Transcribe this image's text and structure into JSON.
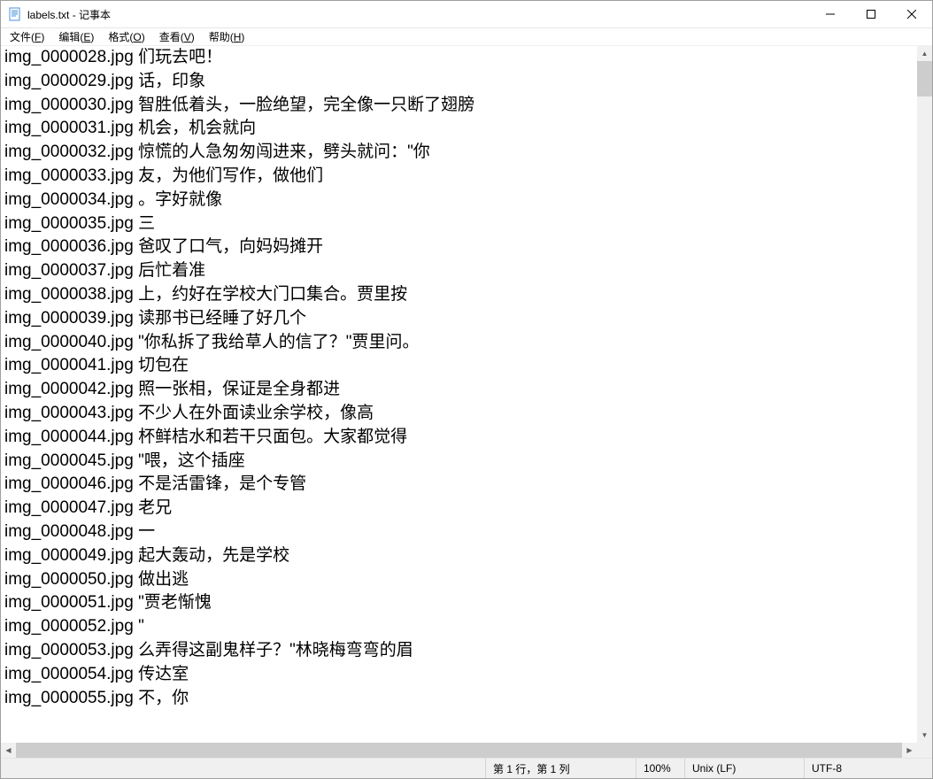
{
  "window": {
    "title": "labels.txt - 记事本"
  },
  "menu": {
    "file": "文件(",
    "file_u": "F",
    "file_end": ")",
    "edit": "编辑(",
    "edit_u": "E",
    "edit_end": ")",
    "format": "格式(",
    "format_u": "O",
    "format_end": ")",
    "view": "查看(",
    "view_u": "V",
    "view_end": ")",
    "help": "帮助(",
    "help_u": "H",
    "help_end": ")"
  },
  "content": {
    "lines": [
      "img_0000028.jpg 们玩去吧！",
      "img_0000029.jpg 话，印象",
      "img_0000030.jpg 智胜低着头，一脸绝望，完全像一只断了翅膀",
      "img_0000031.jpg 机会，机会就向",
      "img_0000032.jpg 惊慌的人急匆匆闯进来，劈头就问：\"你",
      "img_0000033.jpg 友，为他们写作，做他们",
      "img_0000034.jpg 。字好就像",
      "img_0000035.jpg 三",
      "img_0000036.jpg 爸叹了口气，向妈妈摊开",
      "img_0000037.jpg 后忙着准",
      "img_0000038.jpg 上，约好在学校大门口集合。贾里按",
      "img_0000039.jpg 读那书已经睡了好几个",
      "img_0000040.jpg \"你私拆了我给草人的信了？\"贾里问。",
      "img_0000041.jpg 切包在",
      "img_0000042.jpg 照一张相，保证是全身都进",
      "img_0000043.jpg 不少人在外面读业余学校，像高",
      "img_0000044.jpg 杯鲜桔水和若干只面包。大家都觉得",
      "img_0000045.jpg \"喂，这个插座",
      "img_0000046.jpg 不是活雷锋，是个专管",
      "img_0000047.jpg 老兄",
      "img_0000048.jpg 一",
      "img_0000049.jpg 起大轰动，先是学校",
      "img_0000050.jpg 做出逃",
      "img_0000051.jpg \"贾老惭愧",
      "img_0000052.jpg \"",
      "img_0000053.jpg 么弄得这副鬼样子？\"林晓梅弯弯的眉",
      "img_0000054.jpg 传达室",
      "img_0000055.jpg 不，你"
    ]
  },
  "status": {
    "position": "第 1 行，第 1 列",
    "zoom": "100%",
    "lineending": "Unix (LF)",
    "encoding": "UTF-8"
  }
}
